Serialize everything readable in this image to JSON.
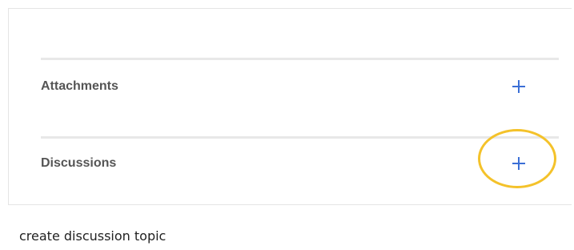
{
  "sections": [
    {
      "label": "Attachments",
      "add_icon": "plus-icon"
    },
    {
      "label": "Discussions",
      "add_icon": "plus-icon",
      "highlighted": true
    }
  ],
  "caption": "create discussion topic",
  "colors": {
    "accent": "#3b6fd6",
    "highlight": "#f4c22a",
    "label": "#555555",
    "divider": "#e8e8e8"
  }
}
